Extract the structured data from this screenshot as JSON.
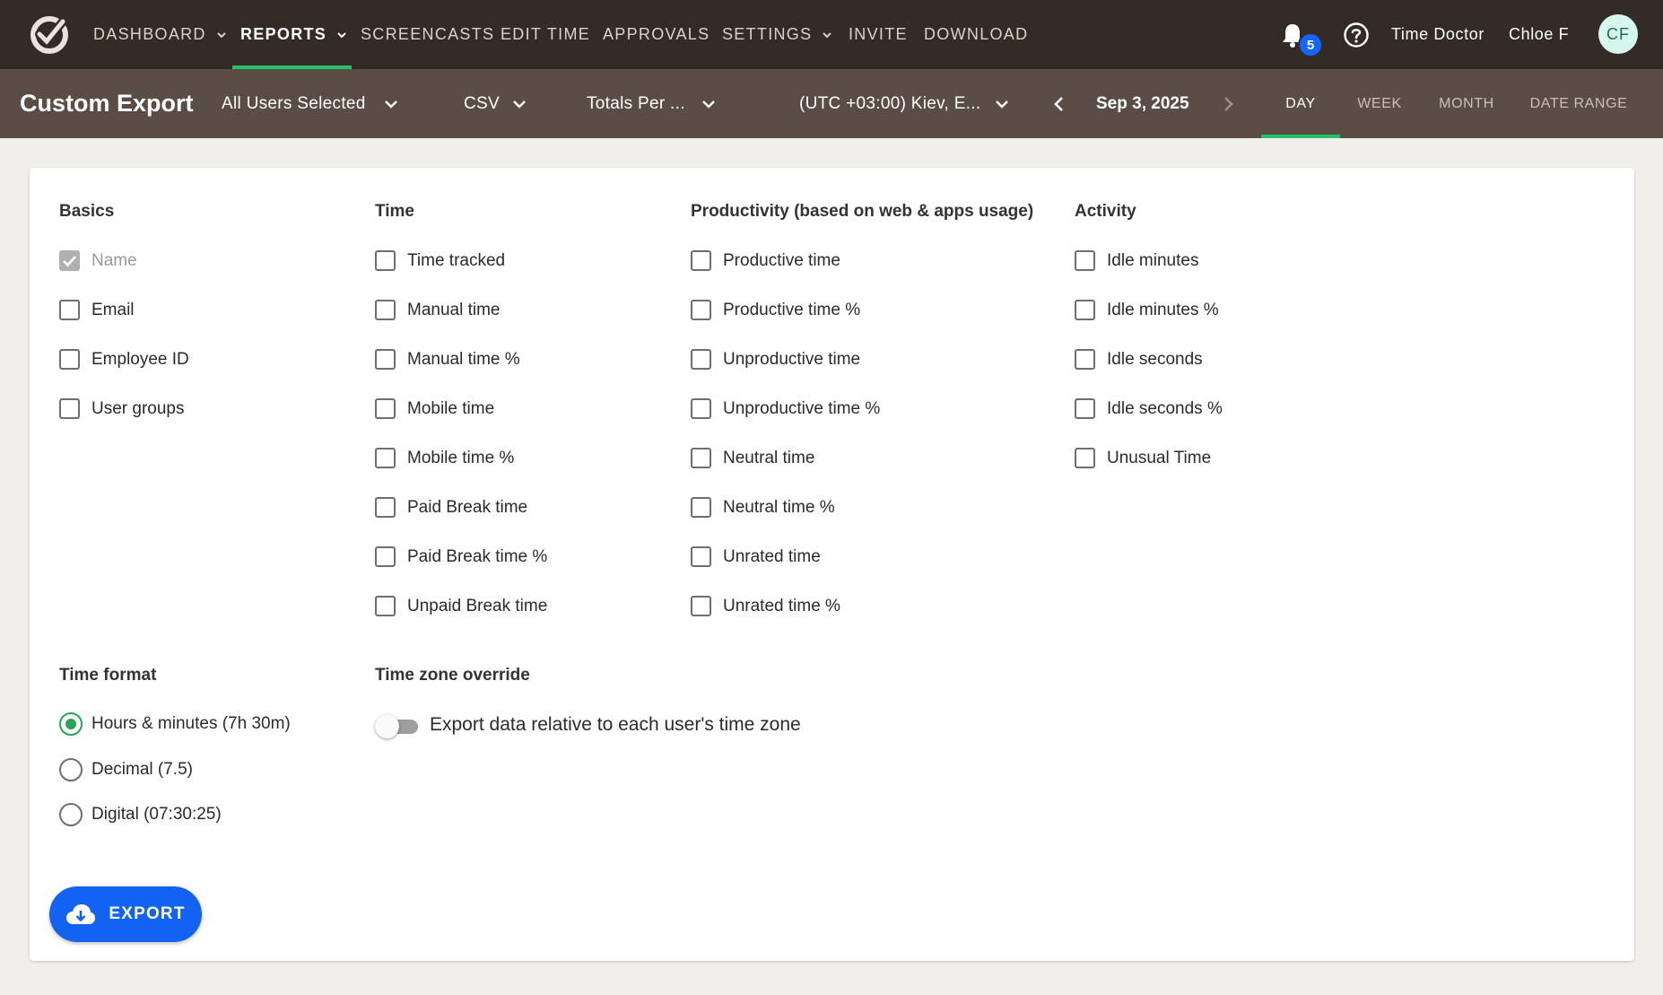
{
  "topnav": {
    "items": [
      {
        "label": "DASHBOARD",
        "dropdown": true
      },
      {
        "label": "REPORTS",
        "dropdown": true,
        "active": true
      },
      {
        "label": "SCREENCASTS"
      },
      {
        "label": "EDIT TIME"
      },
      {
        "label": "APPROVALS"
      },
      {
        "label": "SETTINGS",
        "dropdown": true
      },
      {
        "label": "INVITE"
      },
      {
        "label": "DOWNLOAD"
      }
    ],
    "notification_count": "5",
    "company": "Time Doctor",
    "user": "Chloe F",
    "avatar_initials": "CF",
    "icons": {
      "logo": "time-doctor-logo",
      "bell": "bell-icon",
      "help": "help-icon"
    }
  },
  "subnav": {
    "title": "Custom Export",
    "users_filter": "All Users Selected",
    "format": "CSV",
    "grouping": "Totals Per ...",
    "timezone": "(UTC +03:00) Kiev, E...",
    "date": "Sep 3, 2025",
    "range_tabs": [
      "DAY",
      "WEEK",
      "MONTH",
      "DATE RANGE"
    ],
    "active_range": "DAY"
  },
  "columns": {
    "basics": {
      "title": "Basics",
      "options": [
        {
          "label": "Name",
          "checked": true,
          "disabled": true
        },
        {
          "label": "Email",
          "checked": false
        },
        {
          "label": "Employee ID",
          "checked": false
        },
        {
          "label": "User groups",
          "checked": false
        }
      ]
    },
    "time": {
      "title": "Time",
      "options": [
        {
          "label": "Time tracked",
          "checked": false
        },
        {
          "label": "Manual time",
          "checked": false
        },
        {
          "label": "Manual time %",
          "checked": false
        },
        {
          "label": "Mobile time",
          "checked": false
        },
        {
          "label": "Mobile time %",
          "checked": false
        },
        {
          "label": "Paid Break time",
          "checked": false
        },
        {
          "label": "Paid Break time %",
          "checked": false
        },
        {
          "label": "Unpaid Break time",
          "checked": false
        }
      ]
    },
    "productivity": {
      "title": "Productivity (based on web & apps usage)",
      "options": [
        {
          "label": "Productive time",
          "checked": false
        },
        {
          "label": "Productive time %",
          "checked": false
        },
        {
          "label": "Unproductive time",
          "checked": false
        },
        {
          "label": "Unproductive time %",
          "checked": false
        },
        {
          "label": "Neutral time",
          "checked": false
        },
        {
          "label": "Neutral time %",
          "checked": false
        },
        {
          "label": "Unrated time",
          "checked": false
        },
        {
          "label": "Unrated time %",
          "checked": false
        }
      ]
    },
    "activity": {
      "title": "Activity",
      "options": [
        {
          "label": "Idle minutes",
          "checked": false
        },
        {
          "label": "Idle minutes %",
          "checked": false
        },
        {
          "label": "Idle seconds",
          "checked": false
        },
        {
          "label": "Idle seconds %",
          "checked": false
        },
        {
          "label": "Unusual Time",
          "checked": false
        }
      ]
    }
  },
  "time_format": {
    "title": "Time format",
    "options": [
      {
        "label": "Hours & minutes (7h 30m)",
        "selected": true
      },
      {
        "label": "Decimal (7.5)",
        "selected": false
      },
      {
        "label": "Digital (07:30:25)",
        "selected": false
      }
    ]
  },
  "timezone_override": {
    "title": "Time zone override",
    "toggle_label": "Export data relative to each user's time zone",
    "enabled": false
  },
  "export_button": {
    "label": "EXPORT",
    "icon": "cloud-download-icon"
  },
  "colors": {
    "accent_green": "#27c06b",
    "primary_blue": "#1263f1",
    "topbar": "#342b27",
    "subbar": "#5a4d45"
  }
}
